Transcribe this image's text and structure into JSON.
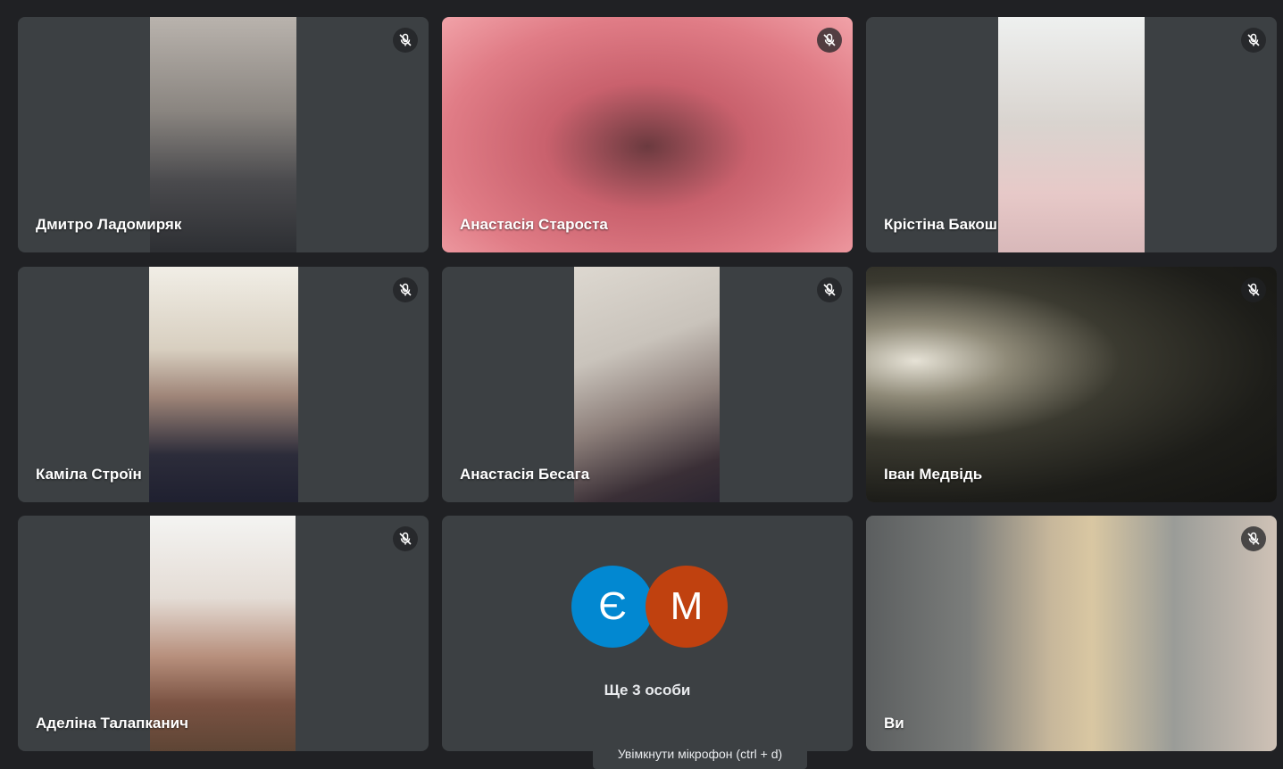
{
  "participants": [
    {
      "name": "Дмитро Ладомиряк",
      "muted": true
    },
    {
      "name": "Анастасія Староста",
      "muted": true
    },
    {
      "name": "Крістіна Бакош",
      "muted": true
    },
    {
      "name": "Каміла Строїн",
      "muted": true
    },
    {
      "name": "Анастасія Бесага",
      "muted": true
    },
    {
      "name": "Іван Медвідь",
      "muted": true
    },
    {
      "name": "Аделіна Талапканич",
      "muted": true
    },
    {
      "name": "Ви",
      "muted": true
    }
  ],
  "others": {
    "avatars": [
      {
        "letter": "Є",
        "color": "#0288d1"
      },
      {
        "letter": "М",
        "color": "#c0410f"
      }
    ],
    "label": "Ще 3 особи"
  },
  "tooltip": {
    "text": "Увімкнути мікрофон (ctrl + d)"
  },
  "icons": {
    "mic_off": "mic-off-icon"
  },
  "colors": {
    "background": "#202124",
    "tile": "#3c4043"
  }
}
